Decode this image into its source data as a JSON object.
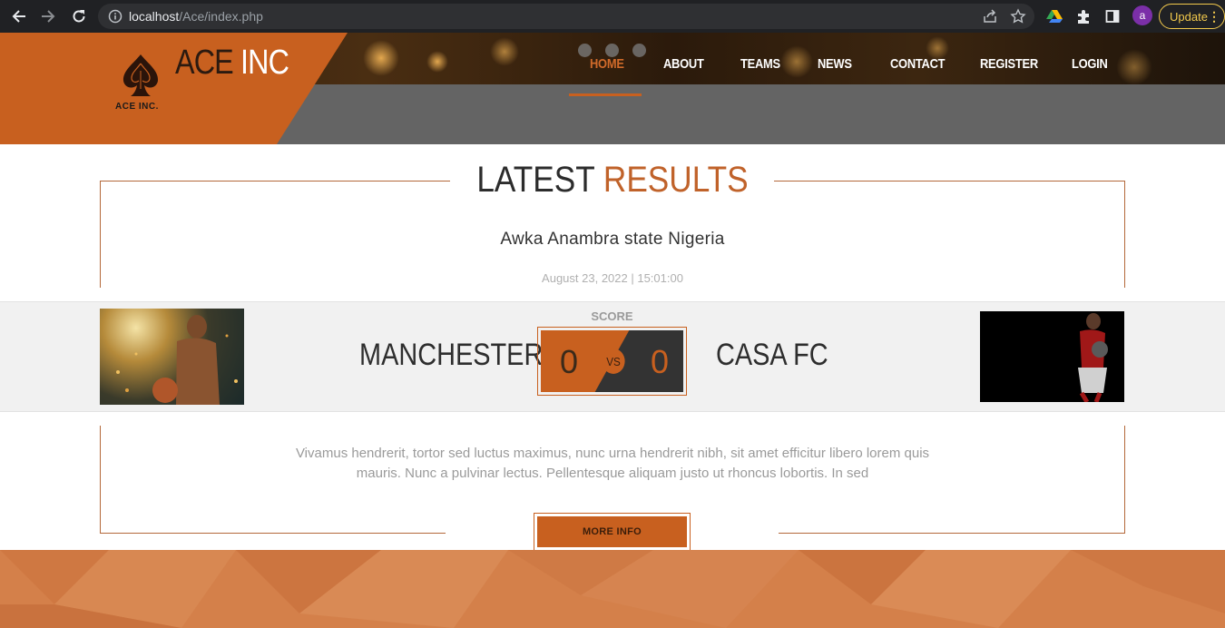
{
  "browser": {
    "url_host": "localhost",
    "url_path": "/Ace/index.php",
    "profile_initial": "a",
    "update_label": "Update",
    "icons": [
      "back-icon",
      "forward-icon",
      "reload-icon",
      "info-icon",
      "share-icon",
      "star-icon",
      "drive-icon",
      "extensions-icon",
      "sidepanel-icon",
      "more-icon"
    ]
  },
  "header": {
    "brand_part1": "ACE ",
    "brand_part2": "INC",
    "brand_caption": "ACE INC.",
    "nav": [
      {
        "label": "HOME",
        "active": true
      },
      {
        "label": "ABOUT",
        "active": false
      },
      {
        "label": "TEAMS",
        "active": false
      },
      {
        "label": "NEWS",
        "active": false
      },
      {
        "label": "CONTACT",
        "active": false
      },
      {
        "label": "REGISTER",
        "active": false
      },
      {
        "label": "LOGIN",
        "active": false
      }
    ]
  },
  "results": {
    "title_part1": "LATEST ",
    "title_part2": "RESULTS",
    "location": "Awka Anambra state Nigeria",
    "datetime": "August 23, 2022 | 15:01:00",
    "score_label": "SCORE",
    "home_team": "MANCHESTER",
    "away_team": "CASA FC",
    "home_score": "0",
    "away_score": "0",
    "vs": "VS",
    "description": "Vivamus hendrerit, tortor sed luctus maximus, nunc urna hendrerit nibh, sit amet efficitur libero lorem quis mauris. Nunc a pulvinar lectus. Pellentesque aliquam justo ut rhoncus lobortis. In sed",
    "more_label": "MORE INFO"
  },
  "colors": {
    "accent": "#c8601f",
    "header_gray": "#646464",
    "footer": "#d4804a",
    "chrome": "#202124"
  }
}
